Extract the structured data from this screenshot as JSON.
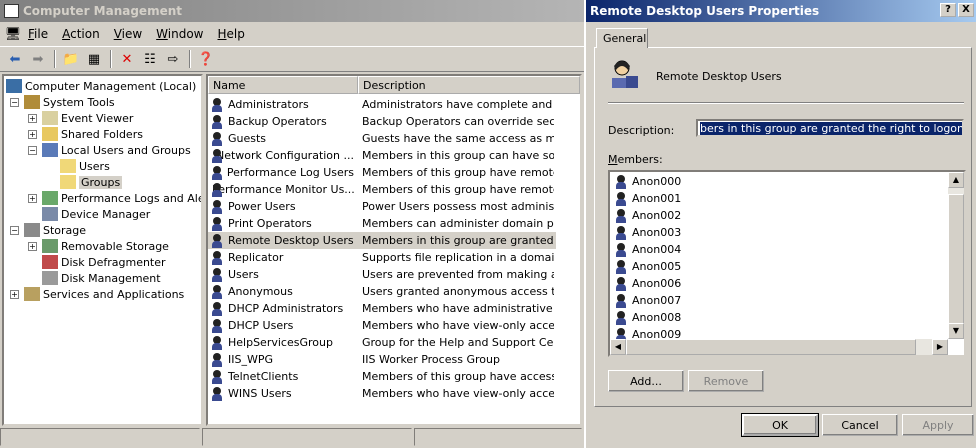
{
  "main_window": {
    "title": "Computer Management",
    "menu": [
      "File",
      "Action",
      "View",
      "Window",
      "Help"
    ],
    "menu_access": [
      "F",
      "A",
      "V",
      "W",
      "H"
    ]
  },
  "tree": {
    "root": "Computer Management (Local)",
    "system_tools": "System Tools",
    "event_viewer": "Event Viewer",
    "shared_folders": "Shared Folders",
    "local_users_groups": "Local Users and Groups",
    "users": "Users",
    "groups": "Groups",
    "perf_logs": "Performance Logs and Alerts",
    "device_manager": "Device Manager",
    "storage": "Storage",
    "removable_storage": "Removable Storage",
    "disk_defrag": "Disk Defragmenter",
    "disk_mgmt": "Disk Management",
    "services_apps": "Services and Applications"
  },
  "list": {
    "col_name": "Name",
    "col_desc": "Description",
    "rows": [
      {
        "name": "Administrators",
        "desc": "Administrators have complete and u..."
      },
      {
        "name": "Backup Operators",
        "desc": "Backup Operators can override secu..."
      },
      {
        "name": "Guests",
        "desc": "Guests have the same access as me..."
      },
      {
        "name": "Network Configuration ...",
        "desc": "Members in this group can have som..."
      },
      {
        "name": "Performance Log Users",
        "desc": "Members of this group have remote ..."
      },
      {
        "name": "Performance Monitor Us...",
        "desc": "Members of this group have remote ..."
      },
      {
        "name": "Power Users",
        "desc": "Power Users possess most administr..."
      },
      {
        "name": "Print Operators",
        "desc": "Members can administer domain prin..."
      },
      {
        "name": "Remote Desktop Users",
        "desc": "Members in this group are granted t..."
      },
      {
        "name": "Replicator",
        "desc": "Supports file replication in a domain"
      },
      {
        "name": "Users",
        "desc": "Users are prevented from making ac..."
      },
      {
        "name": "Anonymous",
        "desc": "Users granted anonymous access to..."
      },
      {
        "name": "DHCP Administrators",
        "desc": "Members who have administrative a..."
      },
      {
        "name": "DHCP Users",
        "desc": "Members who have view-only acces..."
      },
      {
        "name": "HelpServicesGroup",
        "desc": "Group for the Help and Support Center"
      },
      {
        "name": "IIS_WPG",
        "desc": "IIS Worker Process Group"
      },
      {
        "name": "TelnetClients",
        "desc": "Members of this group have access t..."
      },
      {
        "name": "WINS Users",
        "desc": "Members who have view-only acces..."
      }
    ],
    "selected": "Remote Desktop Users"
  },
  "dialog": {
    "title": "Remote Desktop Users Properties",
    "help_btn": "?",
    "close_btn": "X",
    "tab": "General",
    "group_name": "Remote Desktop Users",
    "description_label": "Description:",
    "description_value": "bers in this group are granted the right to logon remotely",
    "members_label": "Members:",
    "members": [
      "Anon000",
      "Anon001",
      "Anon002",
      "Anon003",
      "Anon004",
      "Anon005",
      "Anon006",
      "Anon007",
      "Anon008",
      "Anon009"
    ],
    "add_btn": "Add...",
    "remove_btn": "Remove",
    "ok": "OK",
    "cancel": "Cancel",
    "apply": "Apply"
  }
}
